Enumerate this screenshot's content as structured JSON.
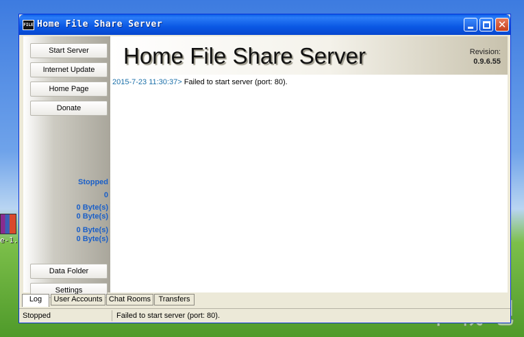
{
  "desktop": {
    "icon_label": "e-1.",
    "watermark": "下载吧"
  },
  "window": {
    "title": "Home File Share Server",
    "app_icon_text": "FILE"
  },
  "sidebar": {
    "buttons": {
      "start_server": "Start Server",
      "internet_update": "Internet Update",
      "home_page": "Home Page",
      "donate": "Donate",
      "data_folder": "Data Folder",
      "settings": "Settings"
    },
    "status": {
      "state": "Stopped",
      "connections": "0",
      "received": "0 Byte(s)",
      "sent": "0 Byte(s)",
      "total_in": "0 Byte(s)",
      "total_out": "0 Byte(s)"
    }
  },
  "header": {
    "title": "Home File Share Server",
    "revision_label": "Revision:",
    "revision_value": "0.9.6.55"
  },
  "log": {
    "entries": [
      {
        "time": "2015-7-23 11:30:37>",
        "message": " Failed to start server (port: 80)."
      }
    ]
  },
  "tabs": [
    "Log",
    "User Accounts",
    "Chat Rooms",
    "Transfers"
  ],
  "statusbar": {
    "state": "Stopped",
    "message": "Failed to start server (port: 80)."
  },
  "colors": {
    "accent_blue": "#1a5fc8",
    "titlebar": "#0a58e4",
    "log_time": "#1a6fa8"
  }
}
